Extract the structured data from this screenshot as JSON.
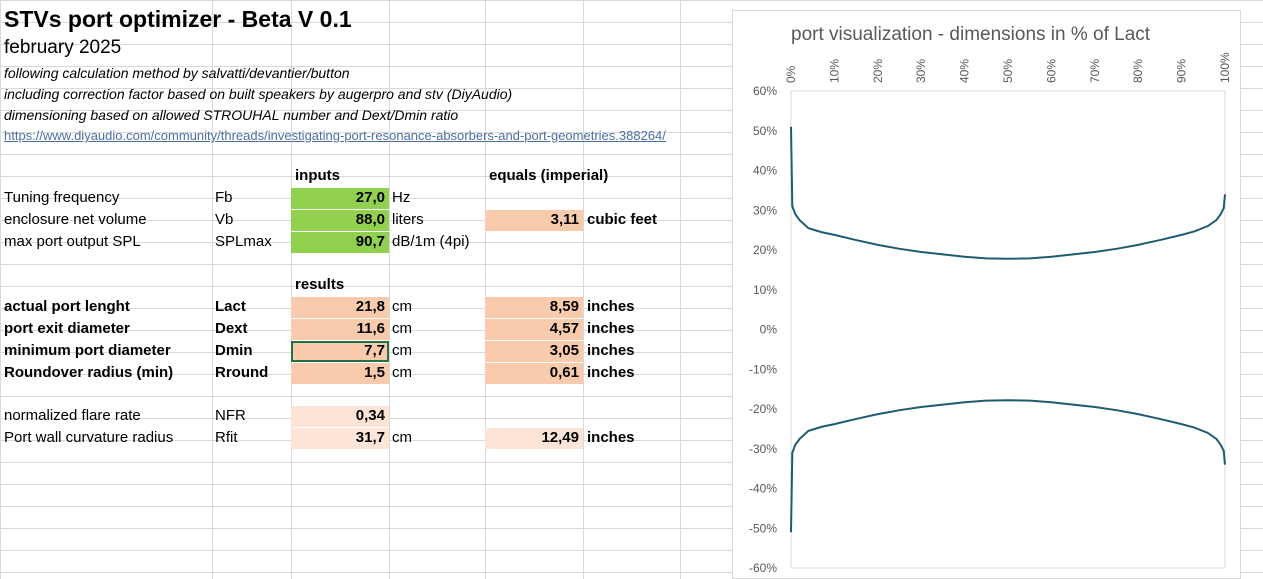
{
  "header": {
    "title": "STVs port optimizer - Beta V 0.1",
    "date": "february 2025",
    "note1": "following calculation method by salvatti/devantier/button",
    "note2": "including correction factor based on built speakers by augerpro and stv (DiyAudio)",
    "note3": "dimensioning based on allowed STROUHAL number and Dext/Dmin ratio",
    "link": "https://www.diyaudio.com/community/threads/investigating-port-resonance-absorbers-and-port-geometries.388264/"
  },
  "inputs": {
    "heading": "inputs",
    "imperial_heading": "equals (imperial)",
    "rows": [
      {
        "label": "Tuning frequency",
        "symbol": "Fb",
        "value": "27,0",
        "unit": "Hz",
        "imp_value": "",
        "imp_unit": ""
      },
      {
        "label": "enclosure net volume",
        "symbol": "Vb",
        "value": "88,0",
        "unit": "liters",
        "imp_value": "3,11",
        "imp_unit": "cubic feet"
      },
      {
        "label": "max port output SPL",
        "symbol": "SPLmax",
        "value": "90,7",
        "unit": "dB/1m (4pi)",
        "imp_value": "",
        "imp_unit": ""
      }
    ]
  },
  "results": {
    "heading": "results",
    "rows": [
      {
        "label": "actual port lenght",
        "symbol": "Lact",
        "value": "21,8",
        "unit": "cm",
        "imp_value": "8,59",
        "imp_unit": "inches"
      },
      {
        "label": "port exit diameter",
        "symbol": "Dext",
        "value": "11,6",
        "unit": "cm",
        "imp_value": "4,57",
        "imp_unit": "inches"
      },
      {
        "label": "minimum port diameter",
        "symbol": "Dmin",
        "value": "7,7",
        "unit": "cm",
        "imp_value": "3,05",
        "imp_unit": "inches"
      },
      {
        "label": "Roundover radius (min)",
        "symbol": "Rround",
        "value": "1,5",
        "unit": "cm",
        "imp_value": "0,61",
        "imp_unit": "inches"
      }
    ],
    "extra": [
      {
        "label": "normalized flare rate",
        "symbol": "NFR",
        "value": "0,34",
        "unit": "",
        "imp_value": "",
        "imp_unit": ""
      },
      {
        "label": "Port wall curvature radius",
        "symbol": "Rfit",
        "value": "31,7",
        "unit": "cm",
        "imp_value": "12,49",
        "imp_unit": "inches"
      }
    ]
  },
  "colors": {
    "input_fill": "#92d050",
    "result_fill": "#f8cbad",
    "extra_fill": "#fce4d6",
    "curve": "#1f5b73"
  },
  "chart_data": {
    "type": "line",
    "title": "port visualization - dimensions in % of Lact",
    "x_ticks": [
      "0%",
      "10%",
      "20%",
      "30%",
      "40%",
      "50%",
      "60%",
      "70%",
      "80%",
      "90%",
      "100%"
    ],
    "y_ticks": [
      "60%",
      "50%",
      "40%",
      "30%",
      "20%",
      "10%",
      "0%",
      "-10%",
      "-20%",
      "-30%",
      "-40%",
      "-50%",
      "-60%"
    ],
    "xlim": [
      0,
      100
    ],
    "ylim": [
      -60,
      60
    ],
    "x_axis_position": "top",
    "grid": false,
    "series": [
      {
        "x": [
          0,
          0.3,
          1,
          2,
          4,
          7,
          10,
          15,
          20,
          25,
          30,
          35,
          40,
          45,
          50,
          55,
          60,
          65,
          70,
          75,
          80,
          85,
          90,
          93,
          96,
          98,
          99,
          99.7,
          100
        ],
        "y": [
          51,
          31,
          29,
          27.5,
          25.5,
          24.5,
          23.8,
          22.5,
          21.3,
          20.3,
          19.5,
          18.9,
          18.3,
          17.9,
          17.8,
          17.9,
          18.3,
          18.9,
          19.5,
          20.3,
          21.3,
          22.5,
          23.8,
          24.7,
          26,
          27.5,
          29,
          30.5,
          34
        ]
      },
      {
        "x": [
          0,
          0.3,
          1,
          2,
          4,
          7,
          10,
          15,
          20,
          25,
          30,
          35,
          40,
          45,
          50,
          55,
          60,
          65,
          70,
          75,
          80,
          85,
          90,
          93,
          96,
          98,
          99,
          99.7,
          100
        ],
        "y": [
          -51,
          -31,
          -29,
          -27.5,
          -25.5,
          -24.5,
          -23.8,
          -22.5,
          -21.3,
          -20.3,
          -19.5,
          -18.9,
          -18.3,
          -17.9,
          -17.8,
          -17.9,
          -18.3,
          -18.9,
          -19.5,
          -20.3,
          -21.3,
          -22.5,
          -23.8,
          -24.7,
          -26,
          -27.5,
          -29,
          -30.5,
          -34
        ]
      }
    ]
  }
}
